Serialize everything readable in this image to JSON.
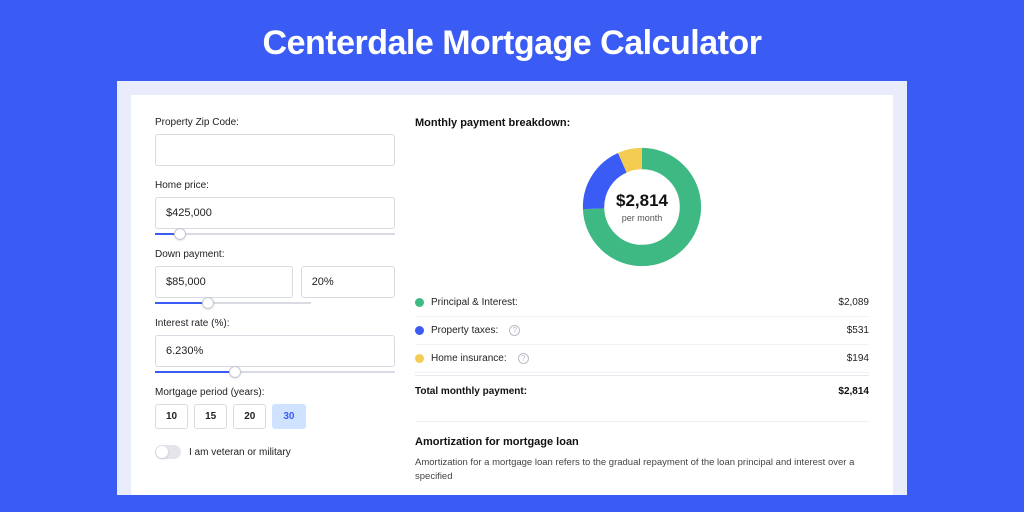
{
  "title": "Centerdale Mortgage Calculator",
  "form": {
    "zip_label": "Property Zip Code:",
    "zip_value": "",
    "home_price_label": "Home price:",
    "home_price_value": "$425,000",
    "down_payment_label": "Down payment:",
    "down_payment_value": "$85,000",
    "down_payment_pct": "20%",
    "interest_label": "Interest rate (%):",
    "interest_value": "6.230%",
    "period_label": "Mortgage period (years):",
    "periods": [
      "10",
      "15",
      "20",
      "30"
    ],
    "period_selected": "30",
    "veteran_label": "I am veteran or military"
  },
  "breakdown": {
    "title": "Monthly payment breakdown:",
    "center_amount": "$2,814",
    "center_sub": "per month",
    "items": [
      {
        "label": "Principal & Interest:",
        "value": "$2,089",
        "color": "#3fb984"
      },
      {
        "label": "Property taxes:",
        "value": "$531",
        "color": "#3a5cf5",
        "info": true
      },
      {
        "label": "Home insurance:",
        "value": "$194",
        "color": "#f5cc52",
        "info": true
      }
    ],
    "total_label": "Total monthly payment:",
    "total_value": "$2,814"
  },
  "amortization": {
    "title": "Amortization for mortgage loan",
    "text": "Amortization for a mortgage loan refers to the gradual repayment of the loan principal and interest over a specified"
  },
  "chart_data": {
    "type": "pie",
    "title": "Monthly payment breakdown",
    "series": [
      {
        "name": "Principal & Interest",
        "value": 2089,
        "color": "#3fb984"
      },
      {
        "name": "Property taxes",
        "value": 531,
        "color": "#3a5cf5"
      },
      {
        "name": "Home insurance",
        "value": 194,
        "color": "#f5cc52"
      }
    ],
    "total": 2814,
    "unit": "USD per month"
  }
}
